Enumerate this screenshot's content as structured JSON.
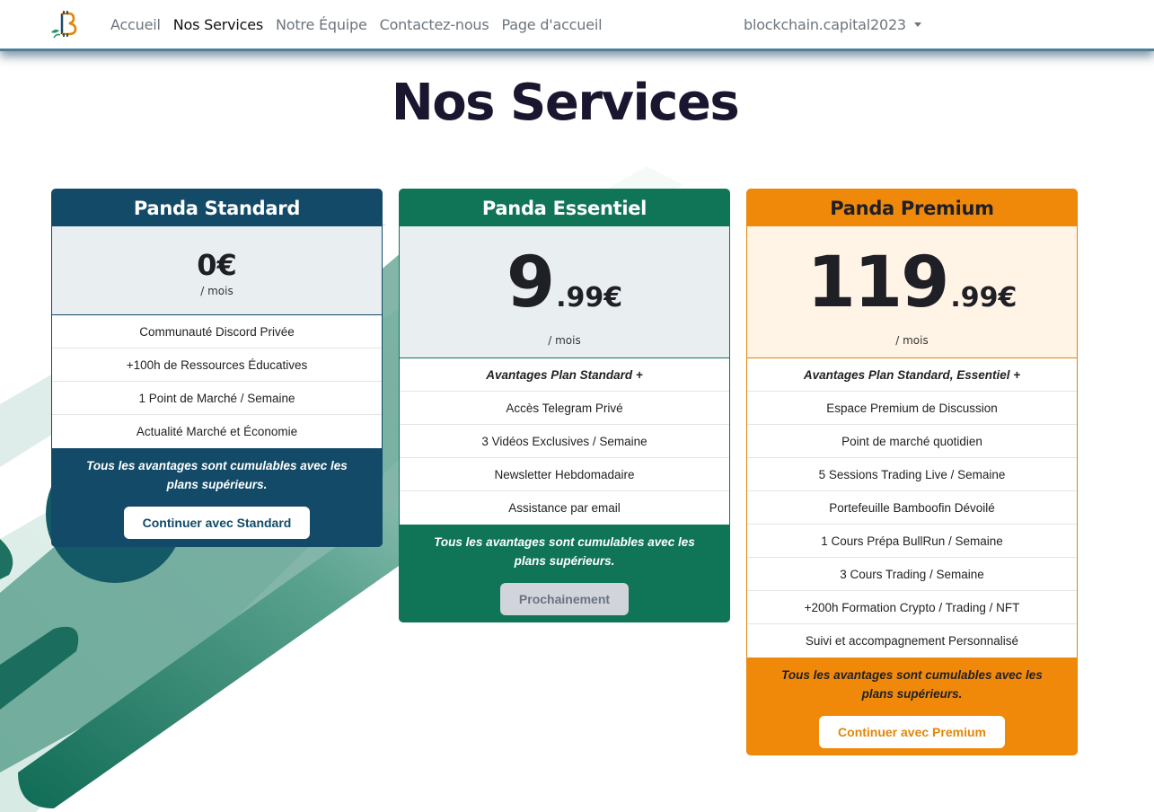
{
  "nav": {
    "links": [
      "Accueil",
      "Nos Services",
      "Notre Équipe",
      "Contactez-nous",
      "Page d'accueil"
    ],
    "active": "Nos Services",
    "account": "blockchain.capital2023"
  },
  "page": {
    "title": "Nos Services"
  },
  "colors": {
    "standard": "#124a68",
    "essentiel": "#107456",
    "premium": "#f0890a",
    "title": "#1b1630"
  },
  "plans": {
    "standard": {
      "name": "Panda Standard",
      "price_main": "0€",
      "period": "/ mois",
      "features": [
        "Communauté Discord Privée",
        "+100h de Ressources Éducatives",
        "1 Point de Marché / Semaine",
        "Actualité Marché et Économie"
      ],
      "note": "Tous les avantages sont cumulables avec les plans supérieurs.",
      "cta": "Continuer avec Standard"
    },
    "essentiel": {
      "name": "Panda Essentiel",
      "price_main": "9",
      "price_cents": ".99€",
      "period": "/ mois",
      "features": [
        "Avantages Plan Standard +",
        "Accès Telegram Privé",
        "3 Vidéos Exclusives / Semaine",
        "Newsletter Hebdomadaire",
        "Assistance par email"
      ],
      "note": "Tous les avantages sont cumulables avec les plans supérieurs.",
      "cta": "Prochainement"
    },
    "premium": {
      "name": "Panda Premium",
      "price_main": "119",
      "price_cents": ".99€",
      "period": "/ mois",
      "features": [
        "Avantages Plan Standard, Essentiel +",
        "Espace Premium de Discussion",
        "Point de marché quotidien",
        "5 Sessions Trading Live / Semaine",
        "Portefeuille Bamboofin Dévoilé",
        "1 Cours Prépa BullRun / Semaine",
        "3 Cours Trading / Semaine",
        "+200h Formation Crypto / Trading / NFT",
        "Suivi et accompagnement Personnalisé"
      ],
      "note": "Tous les avantages sont cumulables avec les plans supérieurs.",
      "cta": "Continuer avec Premium"
    }
  }
}
